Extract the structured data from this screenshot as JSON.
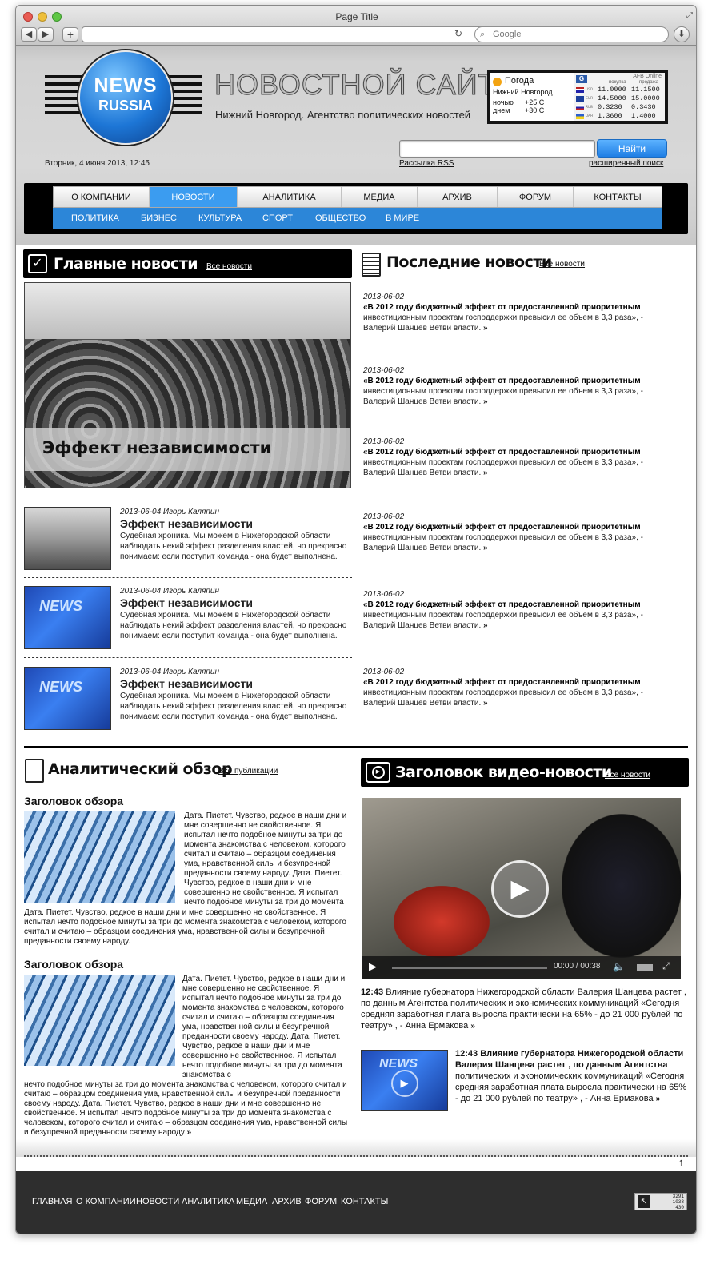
{
  "browser": {
    "title": "Page Title",
    "search_placeholder": "Google",
    "new_tab": "+"
  },
  "header": {
    "logo_line1": "NEWS",
    "logo_line2": "RUSSIA",
    "site_name": "НОВОСТНОЙ САЙТ",
    "tagline": "Нижний Новгород. Агентство политических новостей",
    "date": "Вторник, 4 июня 2013, 12:45",
    "search_value": "",
    "search_button": "Найти",
    "newsletter": "Рассылка",
    "rss": "RSS",
    "advanced_search": "расширенный поиск"
  },
  "weather": {
    "title": "Погода",
    "city": "Нижний Новгород",
    "night_label": "ночью",
    "night_temp": "+25 С",
    "day_label": "днем",
    "day_temp": "+30 С"
  },
  "rates": {
    "brand": "AFB Online",
    "buy_label": "покупка",
    "sell_label": "продажа",
    "rows": [
      {
        "code": "USD",
        "buy": "11.0000",
        "sell": "11.1500"
      },
      {
        "code": "EUR",
        "buy": "14.5000",
        "sell": "15.0000"
      },
      {
        "code": "RUB",
        "buy": "0.3230",
        "sell": "0.3430"
      },
      {
        "code": "UAH",
        "buy": "1.3600",
        "sell": "1.4000"
      }
    ]
  },
  "nav": {
    "main": [
      "О КОМПАНИИ",
      "НОВОСТИ",
      "АНАЛИТИКА",
      "МЕДИА",
      "АРХИВ",
      "ФОРУМ",
      "КОНТАКТЫ"
    ],
    "active": "НОВОСТИ",
    "sub": [
      "ПОЛИТИКА",
      "БИЗНЕС",
      "КУЛЬТУРА",
      "СПОРТ",
      "ОБЩЕСТВО",
      "В МИРЕ"
    ]
  },
  "main_news": {
    "title": "Главные новости",
    "all_link": "Все новости",
    "hero_caption": "Эффект независимости",
    "items": [
      {
        "meta": "2013-06-04 Игорь Каляпин",
        "title": "Эффект независимости",
        "text": "Судебная хроника. Мы можем в Нижегородской области наблюдать некий эффект разделения властей, но прекрасно понимаем: если поступит команда - она будет выполнена."
      },
      {
        "meta": "2013-06-04 Игорь Каляпин",
        "title": "Эффект независимости",
        "text": "Судебная хроника. Мы можем в Нижегородской области наблюдать некий эффект разделения властей, но прекрасно понимаем: если поступит команда - она будет выполнена."
      },
      {
        "meta": "2013-06-04 Игорь Каляпин",
        "title": "Эффект независимости",
        "text": "Судебная хроника. Мы можем в Нижегородской области наблюдать некий эффект разделения властей, но прекрасно понимаем: если поступит команда - она будет выполнена."
      }
    ]
  },
  "latest": {
    "title": "Последние новости",
    "all_link": "Все новости",
    "items": [
      {
        "date": "2013-06-02",
        "headline": "«В 2012 году бюджетный эффект от предоставленной приоритетным",
        "text": "инвестиционным проектам господдержки превысил ее объем в 3,3 раза», - Валерий Шанцев Ветви власти."
      },
      {
        "date": "2013-06-02",
        "headline": "«В 2012 году бюджетный эффект от предоставленной приоритетным",
        "text": "инвестиционным проектам господдержки превысил ее объем в 3,3 раза», - Валерий Шанцев Ветви власти."
      },
      {
        "date": "2013-06-02",
        "headline": "«В 2012 году бюджетный эффект от предоставленной приоритетным",
        "text": "инвестиционным проектам господдержки превысил ее объем в 3,3 раза», - Валерий Шанцев Ветви власти."
      },
      {
        "date": "2013-06-02",
        "headline": "«В 2012 году бюджетный эффект от предоставленной приоритетным",
        "text": "инвестиционным проектам господдержки превысил ее объем в 3,3 раза», - Валерий Шанцев Ветви власти."
      },
      {
        "date": "2013-06-02",
        "headline": "«В 2012 году бюджетный эффект от предоставленной приоритетным",
        "text": "инвестиционным проектам господдержки превысил ее объем в 3,3 раза», - Валерий Шанцев Ветви власти."
      },
      {
        "date": "2013-06-02",
        "headline": "«В 2012 году бюджетный эффект от предоставленной приоритетным",
        "text": "инвестиционным проектам господдержки превысил ее объем в 3,3 раза», - Валерий Шанцев Ветви власти."
      }
    ]
  },
  "analytics": {
    "title": "Аналитический обзор",
    "all_link": "Все публикации",
    "reviews": [
      {
        "title": "Заголовок обзора",
        "side_text": "Дата. Пиетет. Чувство, редкое в наши дни и мне совершенно не свойственное. Я испытал нечто подобное минуты за три до момента знакомства с человеком, которого считал и считаю – образцом соединения ума, нравственной силы и безупречной преданности своему народу. Дата. Пиетет. Чувство, редкое в наши дни и мне совершенно не свойственное. Я испытал нечто подобное минуты за три до момента",
        "full_text": "Дата. Пиетет. Чувство, редкое в наши дни и мне совершенно не свойственное. Я испытал нечто подобное минуты за три до момента знакомства с человеком, которого считал и считаю – образцом соединения ума, нравственной силы и безупречной преданности своему народу."
      },
      {
        "title": "Заголовок обзора",
        "side_text": "Дата. Пиетет. Чувство, редкое в наши дни и мне совершенно не свойственное. Я испытал нечто подобное минуты за три до момента знакомства с человеком, которого считал и считаю – образцом соединения ума, нравственной силы и безупречной преданности своему народу. Дата. Пиетет. Чувство, редкое в наши дни и мне совершенно не свойственное. Я испытал нечто подобное минуты за три до момента знакомства с",
        "full_text": "нечто подобное минуты за три до момента знакомства с человеком, которого считал и считаю – образцом соединения ума, нравственной силы и безупречной преданности своему народу. Дата. Пиетет. Чувство, редкое в наши дни и мне совершенно не свойственное. Я испытал нечто подобное минуты за три до момента знакомства с человеком, которого считал и считаю – образцом соединения ума, нравственной силы и безупречной преданности своему народу"
      }
    ]
  },
  "video": {
    "title": "Заголовок видео-новости",
    "all_link": "Все новости",
    "time": "00:00 / 00:38",
    "item1": {
      "time": "12:43",
      "text": "Влияние губернатора Нижегородской области Валерия Шанцева растет , по данным Агентства политических и экономических коммуникаций «Сегодня средняя заработная плата выросла практически на 65% - до 21 000 рублей по театру» , - Анна Ермакова"
    },
    "item2": {
      "time": "12:43",
      "headline": "Влияние губернатора Нижегородской области Валерия Шанцева растет , по данным Агентства",
      "text": "политических и экономических коммуникаций «Сегодня средняя заработная плата выросла практически на 65% - до 21 000 рублей по театру» , - Анна Ермакова"
    }
  },
  "footer": {
    "links": [
      "ГЛАВНАЯ",
      "О КОМПАНИИ",
      "НОВОСТИ",
      "АНАЛИТИКА",
      "МЕДИА",
      "АРХИВ",
      "ФОРУМ",
      "КОНТАКТЫ"
    ],
    "counter": [
      "3291",
      "1038",
      "430"
    ]
  }
}
